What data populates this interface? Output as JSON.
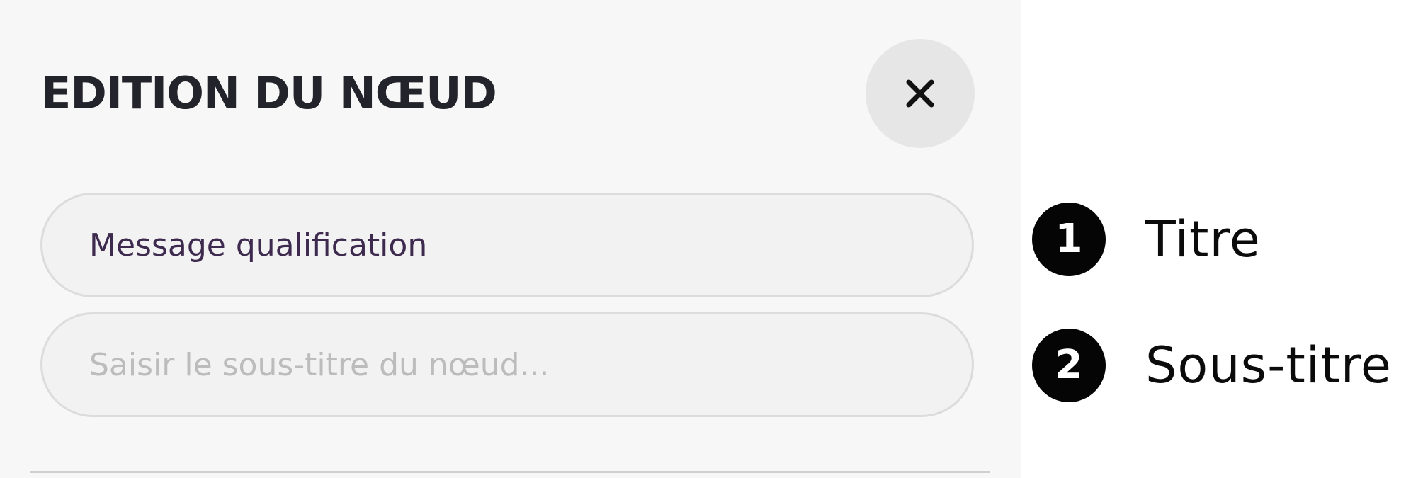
{
  "panel": {
    "title": "EDITION DU NŒUD",
    "close_icon": "close-icon",
    "fields": {
      "title_value": "Message qualification",
      "subtitle_value": "",
      "subtitle_placeholder": "Saisir le sous-titre du nœud..."
    }
  },
  "legend": {
    "items": [
      {
        "number": "1",
        "label": "Titre"
      },
      {
        "number": "2",
        "label": "Sous-titre"
      }
    ]
  },
  "colors": {
    "panel_background": "#f7f7f7",
    "close_button_background": "#e6e6e6",
    "field_background": "#f2f2f2",
    "field_border": "#dcdcdc",
    "title_text": "#23232b",
    "input_text": "#3d2a4e",
    "placeholder_text": "#bcbcbc",
    "badge_background": "#050505"
  }
}
